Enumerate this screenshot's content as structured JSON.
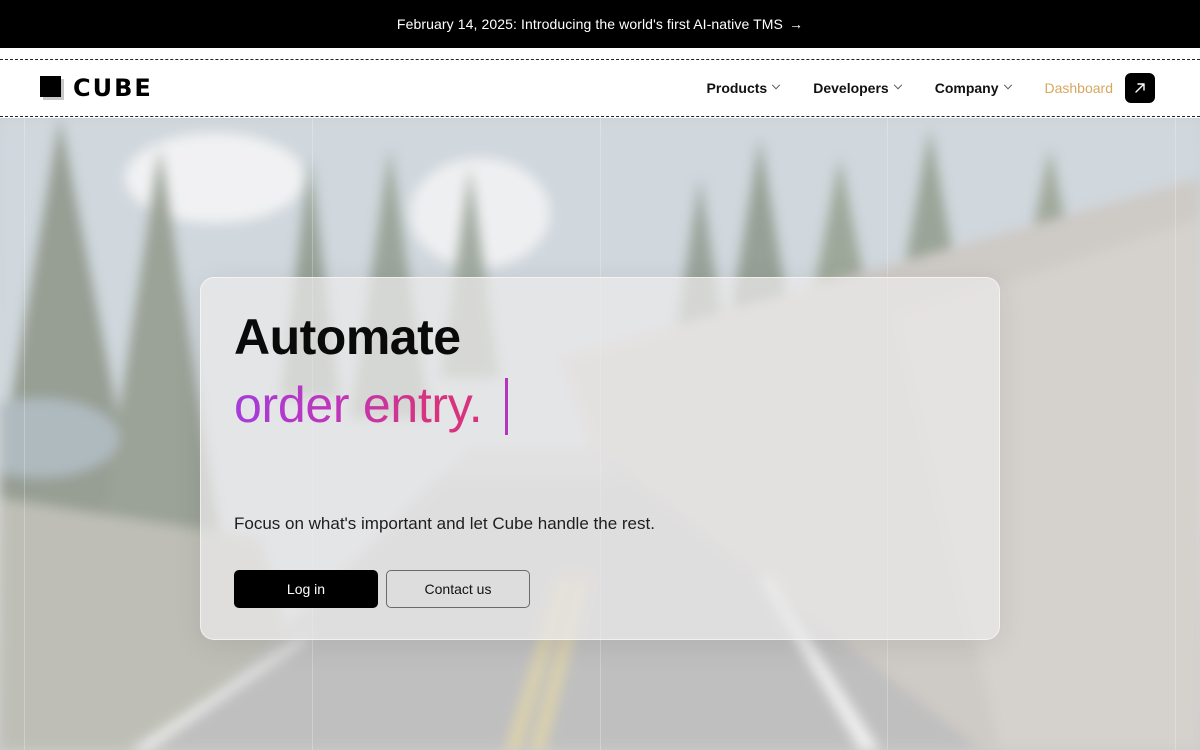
{
  "announcement": {
    "text": "February 14, 2025: Introducing the world's first AI-native TMS",
    "arrow": "→"
  },
  "brand": {
    "name": "CUBE",
    "logo_icon": "cube-logo-icon"
  },
  "nav": {
    "items": [
      {
        "label": "Products",
        "icon": "chevron-down-icon"
      },
      {
        "label": "Developers",
        "icon": "chevron-down-icon"
      },
      {
        "label": "Company",
        "icon": "chevron-down-icon"
      }
    ],
    "dashboard_label": "Dashboard",
    "dashboard_icon": "arrow-up-right-icon"
  },
  "hero": {
    "headline": "Automate",
    "rotating_text": "order entry.",
    "subheading": "Focus on what's important and let Cube handle the rest.",
    "primary_button": "Log in",
    "secondary_button": "Contact us",
    "background": "blurred mountain road with pine trees"
  },
  "colors": {
    "announcement_bg": "#000000",
    "dashboard_link": "#d6a75e",
    "gradient_start": "#a53cdc",
    "gradient_end": "#d8337e"
  }
}
